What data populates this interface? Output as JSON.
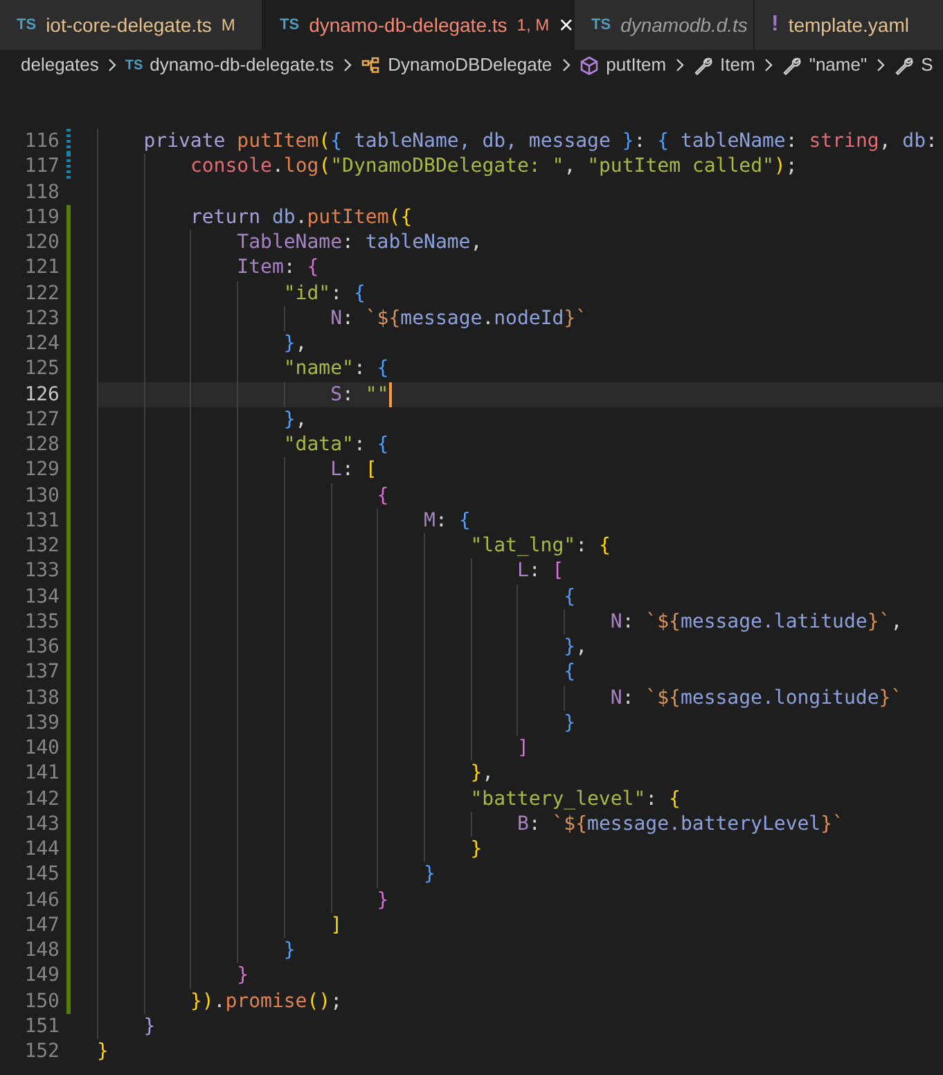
{
  "tabs": [
    {
      "icon": {
        "kind": "ts",
        "text": "TS"
      },
      "label": "iot-core-delegate.ts",
      "modified": true,
      "has_errors": false,
      "badge": "M",
      "preview": false,
      "selected": false
    },
    {
      "icon": {
        "kind": "ts",
        "text": "TS"
      },
      "label": "dynamo-db-delegate.ts",
      "modified": true,
      "has_errors": true,
      "badge": "1, M",
      "preview": false,
      "selected": true,
      "close": "×"
    },
    {
      "icon": {
        "kind": "ts",
        "text": "TS"
      },
      "label": "dynamodb.d.ts",
      "modified": false,
      "has_errors": false,
      "preview": true,
      "selected": false
    },
    {
      "icon": {
        "kind": "yaml",
        "text": "!"
      },
      "label": "template.yaml",
      "modified": true,
      "has_errors": false,
      "preview": false,
      "selected": false
    }
  ],
  "breadcrumbs": [
    {
      "kind": "folder",
      "text": "delegates"
    },
    {
      "kind": "file",
      "icon": "TS",
      "text": "dynamo-db-delegate.ts"
    },
    {
      "kind": "class",
      "text": "DynamoDBDelegate"
    },
    {
      "kind": "method",
      "text": "putItem"
    },
    {
      "kind": "property",
      "text": "Item"
    },
    {
      "kind": "property",
      "text": "\"name\""
    },
    {
      "kind": "property",
      "text": "S"
    }
  ],
  "lines": [
    {
      "number": "116",
      "added": false,
      "modified": true,
      "current": false,
      "tokens": [
        {
          "kind": "kw",
          "text": "    private "
        },
        {
          "kind": "fn",
          "text": "putItem"
        },
        {
          "kind": "b1",
          "text": "("
        },
        {
          "kind": "b3",
          "text": "{"
        },
        {
          "kind": "var",
          "text": " tableName, db, message "
        },
        {
          "kind": "b3",
          "text": "}"
        },
        {
          "kind": "p",
          "text": ": "
        },
        {
          "kind": "b3",
          "text": "{"
        },
        {
          "kind": "var",
          "text": " tableName"
        },
        {
          "kind": "p",
          "text": ": "
        },
        {
          "kind": "type",
          "text": "string"
        },
        {
          "kind": "p",
          "text": ", "
        },
        {
          "kind": "var",
          "text": "db"
        },
        {
          "kind": "p",
          "text": ":"
        }
      ]
    },
    {
      "number": "117",
      "added": false,
      "modified": true,
      "current": false,
      "tokens": [
        {
          "kind": "builtin",
          "text": "        console"
        },
        {
          "kind": "p",
          "text": "."
        },
        {
          "kind": "fn",
          "text": "log"
        },
        {
          "kind": "b1",
          "text": "("
        },
        {
          "kind": "str",
          "text": "\"DynamoDBDelegate: \""
        },
        {
          "kind": "p",
          "text": ", "
        },
        {
          "kind": "str",
          "text": "\"putItem called\""
        },
        {
          "kind": "b1",
          "text": ")"
        },
        {
          "kind": "p",
          "text": ";"
        }
      ]
    },
    {
      "number": "118",
      "added": false,
      "modified": false,
      "current": false
    },
    {
      "number": "119",
      "added": true,
      "modified": false,
      "current": false,
      "tokens": [
        {
          "kind": "kw",
          "text": "        return"
        },
        {
          "kind": "var",
          "text": " db"
        },
        {
          "kind": "p",
          "text": "."
        },
        {
          "kind": "fn",
          "text": "putItem"
        },
        {
          "kind": "b1",
          "text": "({"
        }
      ]
    },
    {
      "number": "120",
      "added": true,
      "modified": false,
      "current": false,
      "tokens": [
        {
          "kind": "prop",
          "text": "            TableName"
        },
        {
          "kind": "p",
          "text": ": "
        },
        {
          "kind": "var",
          "text": "tableName"
        },
        {
          "kind": "p",
          "text": ","
        }
      ]
    },
    {
      "number": "121",
      "added": true,
      "modified": false,
      "current": false,
      "tokens": [
        {
          "kind": "prop",
          "text": "            Item"
        },
        {
          "kind": "p",
          "text": ": "
        },
        {
          "kind": "b2",
          "text": "{"
        }
      ]
    },
    {
      "number": "122",
      "added": true,
      "modified": false,
      "current": false,
      "tokens": [
        {
          "kind": "str",
          "text": "                \"id\""
        },
        {
          "kind": "p",
          "text": ": "
        },
        {
          "kind": "b3",
          "text": "{"
        }
      ]
    },
    {
      "number": "123",
      "added": true,
      "modified": false,
      "current": false,
      "tokens": [
        {
          "kind": "prop",
          "text": "                    N"
        },
        {
          "kind": "p",
          "text": ": "
        },
        {
          "kind": "tpl",
          "text": "`${"
        },
        {
          "kind": "var",
          "text": "message"
        },
        {
          "kind": "p",
          "text": "."
        },
        {
          "kind": "var",
          "text": "nodeId"
        },
        {
          "kind": "tpl",
          "text": "}`"
        }
      ]
    },
    {
      "number": "124",
      "added": true,
      "modified": false,
      "current": false,
      "tokens": [
        {
          "kind": "b3",
          "text": "                }"
        },
        {
          "kind": "p",
          "text": ","
        }
      ]
    },
    {
      "number": "125",
      "added": true,
      "modified": false,
      "current": false,
      "tokens": [
        {
          "kind": "str",
          "text": "                \"name\""
        },
        {
          "kind": "p",
          "text": ": "
        },
        {
          "kind": "b3",
          "text": "{"
        }
      ]
    },
    {
      "number": "126",
      "added": true,
      "modified": false,
      "current": true,
      "tokens": [
        {
          "kind": "prop",
          "text": "                    S"
        },
        {
          "kind": "p",
          "text": ": "
        },
        {
          "kind": "str",
          "text": "\"\""
        }
      ]
    },
    {
      "number": "127",
      "added": true,
      "modified": false,
      "current": false,
      "tokens": [
        {
          "kind": "b3",
          "text": "                }"
        },
        {
          "kind": "p",
          "text": ","
        }
      ]
    },
    {
      "number": "128",
      "added": true,
      "modified": false,
      "current": false,
      "tokens": [
        {
          "kind": "str",
          "text": "                \"data\""
        },
        {
          "kind": "p",
          "text": ": "
        },
        {
          "kind": "b3",
          "text": "{"
        }
      ]
    },
    {
      "number": "129",
      "added": true,
      "modified": false,
      "current": false,
      "tokens": [
        {
          "kind": "prop",
          "text": "                    L"
        },
        {
          "kind": "p",
          "text": ": "
        },
        {
          "kind": "b1",
          "text": "["
        }
      ]
    },
    {
      "number": "130",
      "added": true,
      "modified": false,
      "current": false,
      "tokens": [
        {
          "kind": "b2",
          "text": "                        {"
        }
      ]
    },
    {
      "number": "131",
      "added": true,
      "modified": false,
      "current": false,
      "tokens": [
        {
          "kind": "prop",
          "text": "                            M"
        },
        {
          "kind": "p",
          "text": ": "
        },
        {
          "kind": "b3",
          "text": "{"
        }
      ]
    },
    {
      "number": "132",
      "added": true,
      "modified": false,
      "current": false,
      "tokens": [
        {
          "kind": "str",
          "text": "                                \"lat_lng\""
        },
        {
          "kind": "p",
          "text": ": "
        },
        {
          "kind": "b1",
          "text": "{"
        }
      ]
    },
    {
      "number": "133",
      "added": true,
      "modified": false,
      "current": false,
      "tokens": [
        {
          "kind": "prop",
          "text": "                                    L"
        },
        {
          "kind": "p",
          "text": ": "
        },
        {
          "kind": "b2",
          "text": "["
        }
      ]
    },
    {
      "number": "134",
      "added": true,
      "modified": false,
      "current": false,
      "tokens": [
        {
          "kind": "b3",
          "text": "                                        {"
        }
      ]
    },
    {
      "number": "135",
      "added": true,
      "modified": false,
      "current": false,
      "tokens": [
        {
          "kind": "prop",
          "text": "                                            N"
        },
        {
          "kind": "p",
          "text": ": "
        },
        {
          "kind": "tpl",
          "text": "`${"
        },
        {
          "kind": "var",
          "text": "message.latitude"
        },
        {
          "kind": "tpl",
          "text": "}`"
        },
        {
          "kind": "p",
          "text": ","
        }
      ]
    },
    {
      "number": "136",
      "added": true,
      "modified": false,
      "current": false,
      "tokens": [
        {
          "kind": "b3",
          "text": "                                        }"
        },
        {
          "kind": "p",
          "text": ","
        }
      ]
    },
    {
      "number": "137",
      "added": true,
      "modified": false,
      "current": false,
      "tokens": [
        {
          "kind": "b3",
          "text": "                                        {"
        }
      ]
    },
    {
      "number": "138",
      "added": true,
      "modified": false,
      "current": false,
      "tokens": [
        {
          "kind": "prop",
          "text": "                                            N"
        },
        {
          "kind": "p",
          "text": ": "
        },
        {
          "kind": "tpl",
          "text": "`${"
        },
        {
          "kind": "var",
          "text": "message.longitude"
        },
        {
          "kind": "tpl",
          "text": "}`"
        }
      ]
    },
    {
      "number": "139",
      "added": true,
      "modified": false,
      "current": false,
      "tokens": [
        {
          "kind": "b3",
          "text": "                                        }"
        }
      ]
    },
    {
      "number": "140",
      "added": true,
      "modified": false,
      "current": false,
      "tokens": [
        {
          "kind": "b2",
          "text": "                                    ]"
        }
      ]
    },
    {
      "number": "141",
      "added": true,
      "modified": false,
      "current": false,
      "tokens": [
        {
          "kind": "b1",
          "text": "                                }"
        },
        {
          "kind": "p",
          "text": ","
        }
      ]
    },
    {
      "number": "142",
      "added": true,
      "modified": false,
      "current": false,
      "tokens": [
        {
          "kind": "str",
          "text": "                                \"battery_level\""
        },
        {
          "kind": "p",
          "text": ": "
        },
        {
          "kind": "b1",
          "text": "{"
        }
      ]
    },
    {
      "number": "143",
      "added": true,
      "modified": false,
      "current": false,
      "tokens": [
        {
          "kind": "prop",
          "text": "                                    B"
        },
        {
          "kind": "p",
          "text": ": "
        },
        {
          "kind": "tpl",
          "text": "`${"
        },
        {
          "kind": "var",
          "text": "message.batteryLevel"
        },
        {
          "kind": "tpl",
          "text": "}`"
        }
      ]
    },
    {
      "number": "144",
      "added": true,
      "modified": false,
      "current": false,
      "tokens": [
        {
          "kind": "b1",
          "text": "                                }"
        }
      ]
    },
    {
      "number": "145",
      "added": true,
      "modified": false,
      "current": false,
      "tokens": [
        {
          "kind": "b3",
          "text": "                            }"
        }
      ]
    },
    {
      "number": "146",
      "added": true,
      "modified": false,
      "current": false,
      "tokens": [
        {
          "kind": "b2",
          "text": "                        }"
        }
      ]
    },
    {
      "number": "147",
      "added": true,
      "modified": false,
      "current": false,
      "tokens": [
        {
          "kind": "b1",
          "text": "                    ]"
        }
      ]
    },
    {
      "number": "148",
      "added": true,
      "modified": false,
      "current": false,
      "tokens": [
        {
          "kind": "b3",
          "text": "                }"
        }
      ]
    },
    {
      "number": "149",
      "added": true,
      "modified": false,
      "current": false,
      "tokens": [
        {
          "kind": "b2",
          "text": "            }"
        }
      ]
    },
    {
      "number": "150",
      "added": true,
      "modified": false,
      "current": false,
      "tokens": [
        {
          "kind": "b1",
          "text": "        })"
        },
        {
          "kind": "p",
          "text": "."
        },
        {
          "kind": "fn",
          "text": "promise"
        },
        {
          "kind": "b1",
          "text": "()"
        },
        {
          "kind": "p",
          "text": ";"
        }
      ]
    },
    {
      "number": "151",
      "added": false,
      "modified": false,
      "current": false,
      "tokens": [
        {
          "kind": "kw",
          "text": "    }"
        }
      ]
    },
    {
      "number": "152",
      "added": false,
      "modified": false,
      "current": false,
      "tokens": [
        {
          "kind": "b1",
          "text": "}"
        }
      ]
    }
  ]
}
